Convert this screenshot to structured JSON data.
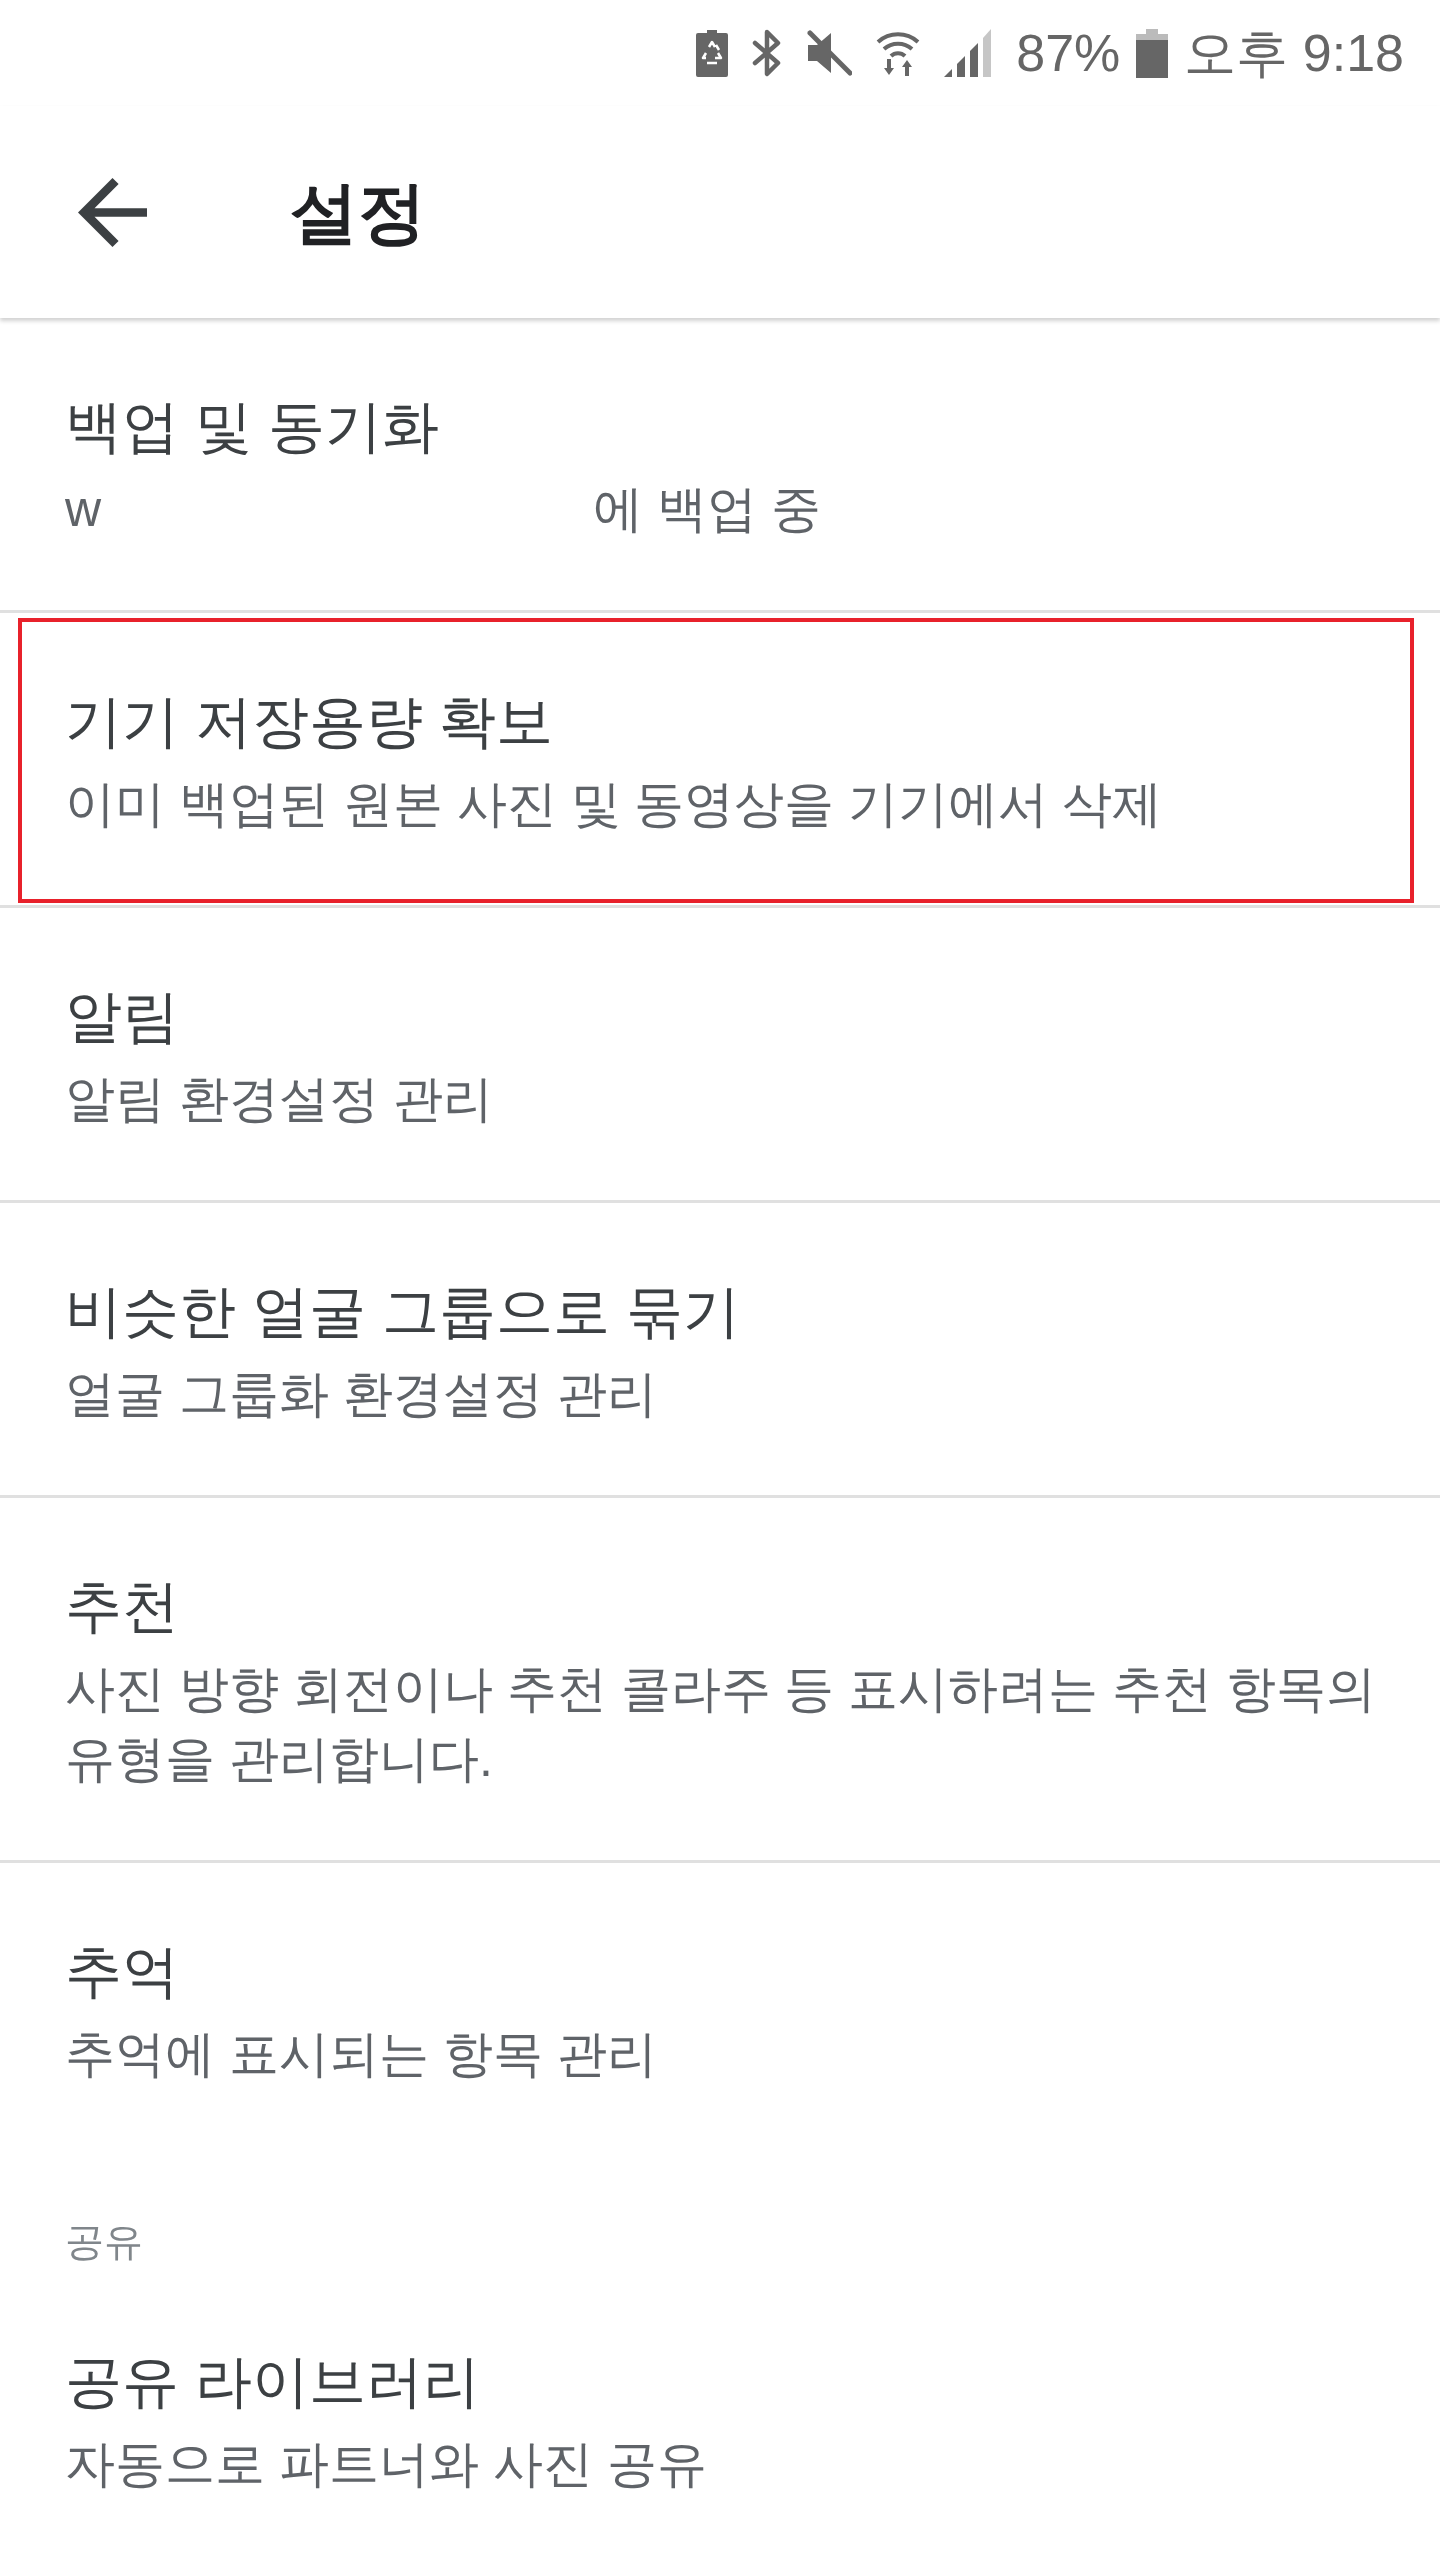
{
  "status_bar": {
    "battery_percent": "87%",
    "time": "오후 9:18"
  },
  "header": {
    "title": "설정"
  },
  "sections": [
    {
      "items": [
        {
          "title": "백업 및 동기화",
          "subtitle_parts": [
            "w",
            "에 백업 중"
          ],
          "highlighted": false
        },
        {
          "title": "기기 저장용량 확보",
          "subtitle": "이미 백업된 원본 사진 및 동영상을 기기에서 삭제",
          "highlighted": true
        },
        {
          "title": "알림",
          "subtitle": "알림 환경설정 관리",
          "highlighted": false
        },
        {
          "title": "비슷한 얼굴 그룹으로 묶기",
          "subtitle": "얼굴 그룹화 환경설정 관리",
          "highlighted": false
        },
        {
          "title": "추천",
          "subtitle": "사진 방향 회전이나 추천 콜라주 등 표시하려는 추천 항목의 유형을 관리합니다.",
          "highlighted": false
        },
        {
          "title": "추억",
          "subtitle": "추억에 표시되는 항목 관리",
          "highlighted": false
        }
      ]
    },
    {
      "header": "공유",
      "items": [
        {
          "title": "공유 라이브러리",
          "subtitle": "자동으로 파트너와 사진 공유",
          "highlighted": false
        }
      ]
    }
  ]
}
